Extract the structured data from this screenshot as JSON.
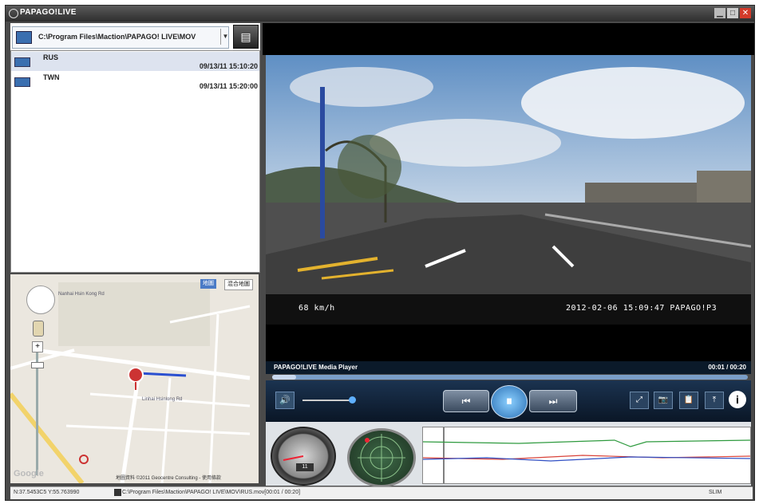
{
  "window": {
    "title": "PAPAGO!LIVE",
    "buttons": {
      "minimize": "▁",
      "maximize": "□",
      "close": "✕"
    }
  },
  "file_browser": {
    "path": "C:\\Program Files\\Maction\\PAPAGO! LIVE\\MOV",
    "dropdown_glyph": "▼",
    "files": [
      {
        "name": "RUS",
        "datetime": "09/13/11 15:10:20",
        "selected": true
      },
      {
        "name": "TWN",
        "datetime": "09/13/11 15:20:00",
        "selected": false
      }
    ]
  },
  "map": {
    "tabs": [
      "地圖",
      "混合地圖"
    ],
    "zoom_plus": "+",
    "copyright": "地圖資料 ©2011 Geocentre Consulting - 使用條款",
    "logo": "Google",
    "labels": [
      "Nanhai Hsin Kong Rd",
      "Linhai Hsinlong Rd"
    ]
  },
  "video": {
    "speed_overlay": "68 km/h",
    "timestamp_overlay": "2012-02-06 15:09:47 PAPAGO!P3"
  },
  "player": {
    "title": "PAPAGO!LIVE Media Player",
    "time": "00:01 / 00:20",
    "progress": 0.05,
    "volume": 0.95,
    "buttons": {
      "volume": "🔊",
      "prev": "⏮",
      "pause": "⏸",
      "next": "⏭",
      "info": "i"
    },
    "tools": [
      "⤢",
      "📷",
      "📋",
      "⤒"
    ]
  },
  "gauges": {
    "speed_value": "11",
    "graph_colors": {
      "green": "#2e9a3e",
      "red": "#d9433a",
      "blue": "#2f4fc4"
    }
  },
  "status_bar": {
    "gps": "N:37.5453C5 Y:55.763990",
    "file": "C:\\Program Files\\Maction\\PAPAGO! LIVE\\MOV\\RUS.mov[00:01 / 00:20]",
    "right": "SLIM"
  }
}
